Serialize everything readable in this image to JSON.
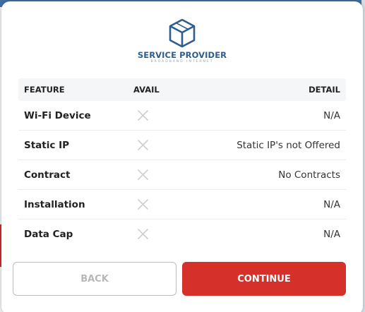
{
  "logo": {
    "title": "SERVICE PROVIDER",
    "subtitle": "BROADBAND INTERNET"
  },
  "table": {
    "headers": {
      "feature": "FEATURE",
      "avail": "AVAIL",
      "detail": "DETAIL"
    },
    "rows": [
      {
        "feature": "Wi-Fi Device",
        "available": false,
        "detail": "N/A"
      },
      {
        "feature": "Static IP",
        "available": false,
        "detail": "Static IP's not Offered"
      },
      {
        "feature": "Contract",
        "available": false,
        "detail": "No Contracts"
      },
      {
        "feature": "Installation",
        "available": false,
        "detail": "N/A"
      },
      {
        "feature": "Data Cap",
        "available": false,
        "detail": "N/A"
      }
    ]
  },
  "buttons": {
    "back_label": "BACK",
    "continue_label": "CONTINUE"
  },
  "colors": {
    "accent": "#d5302a",
    "brand": "#2e5d8f",
    "unavailable_icon": "#cfcfcf"
  }
}
